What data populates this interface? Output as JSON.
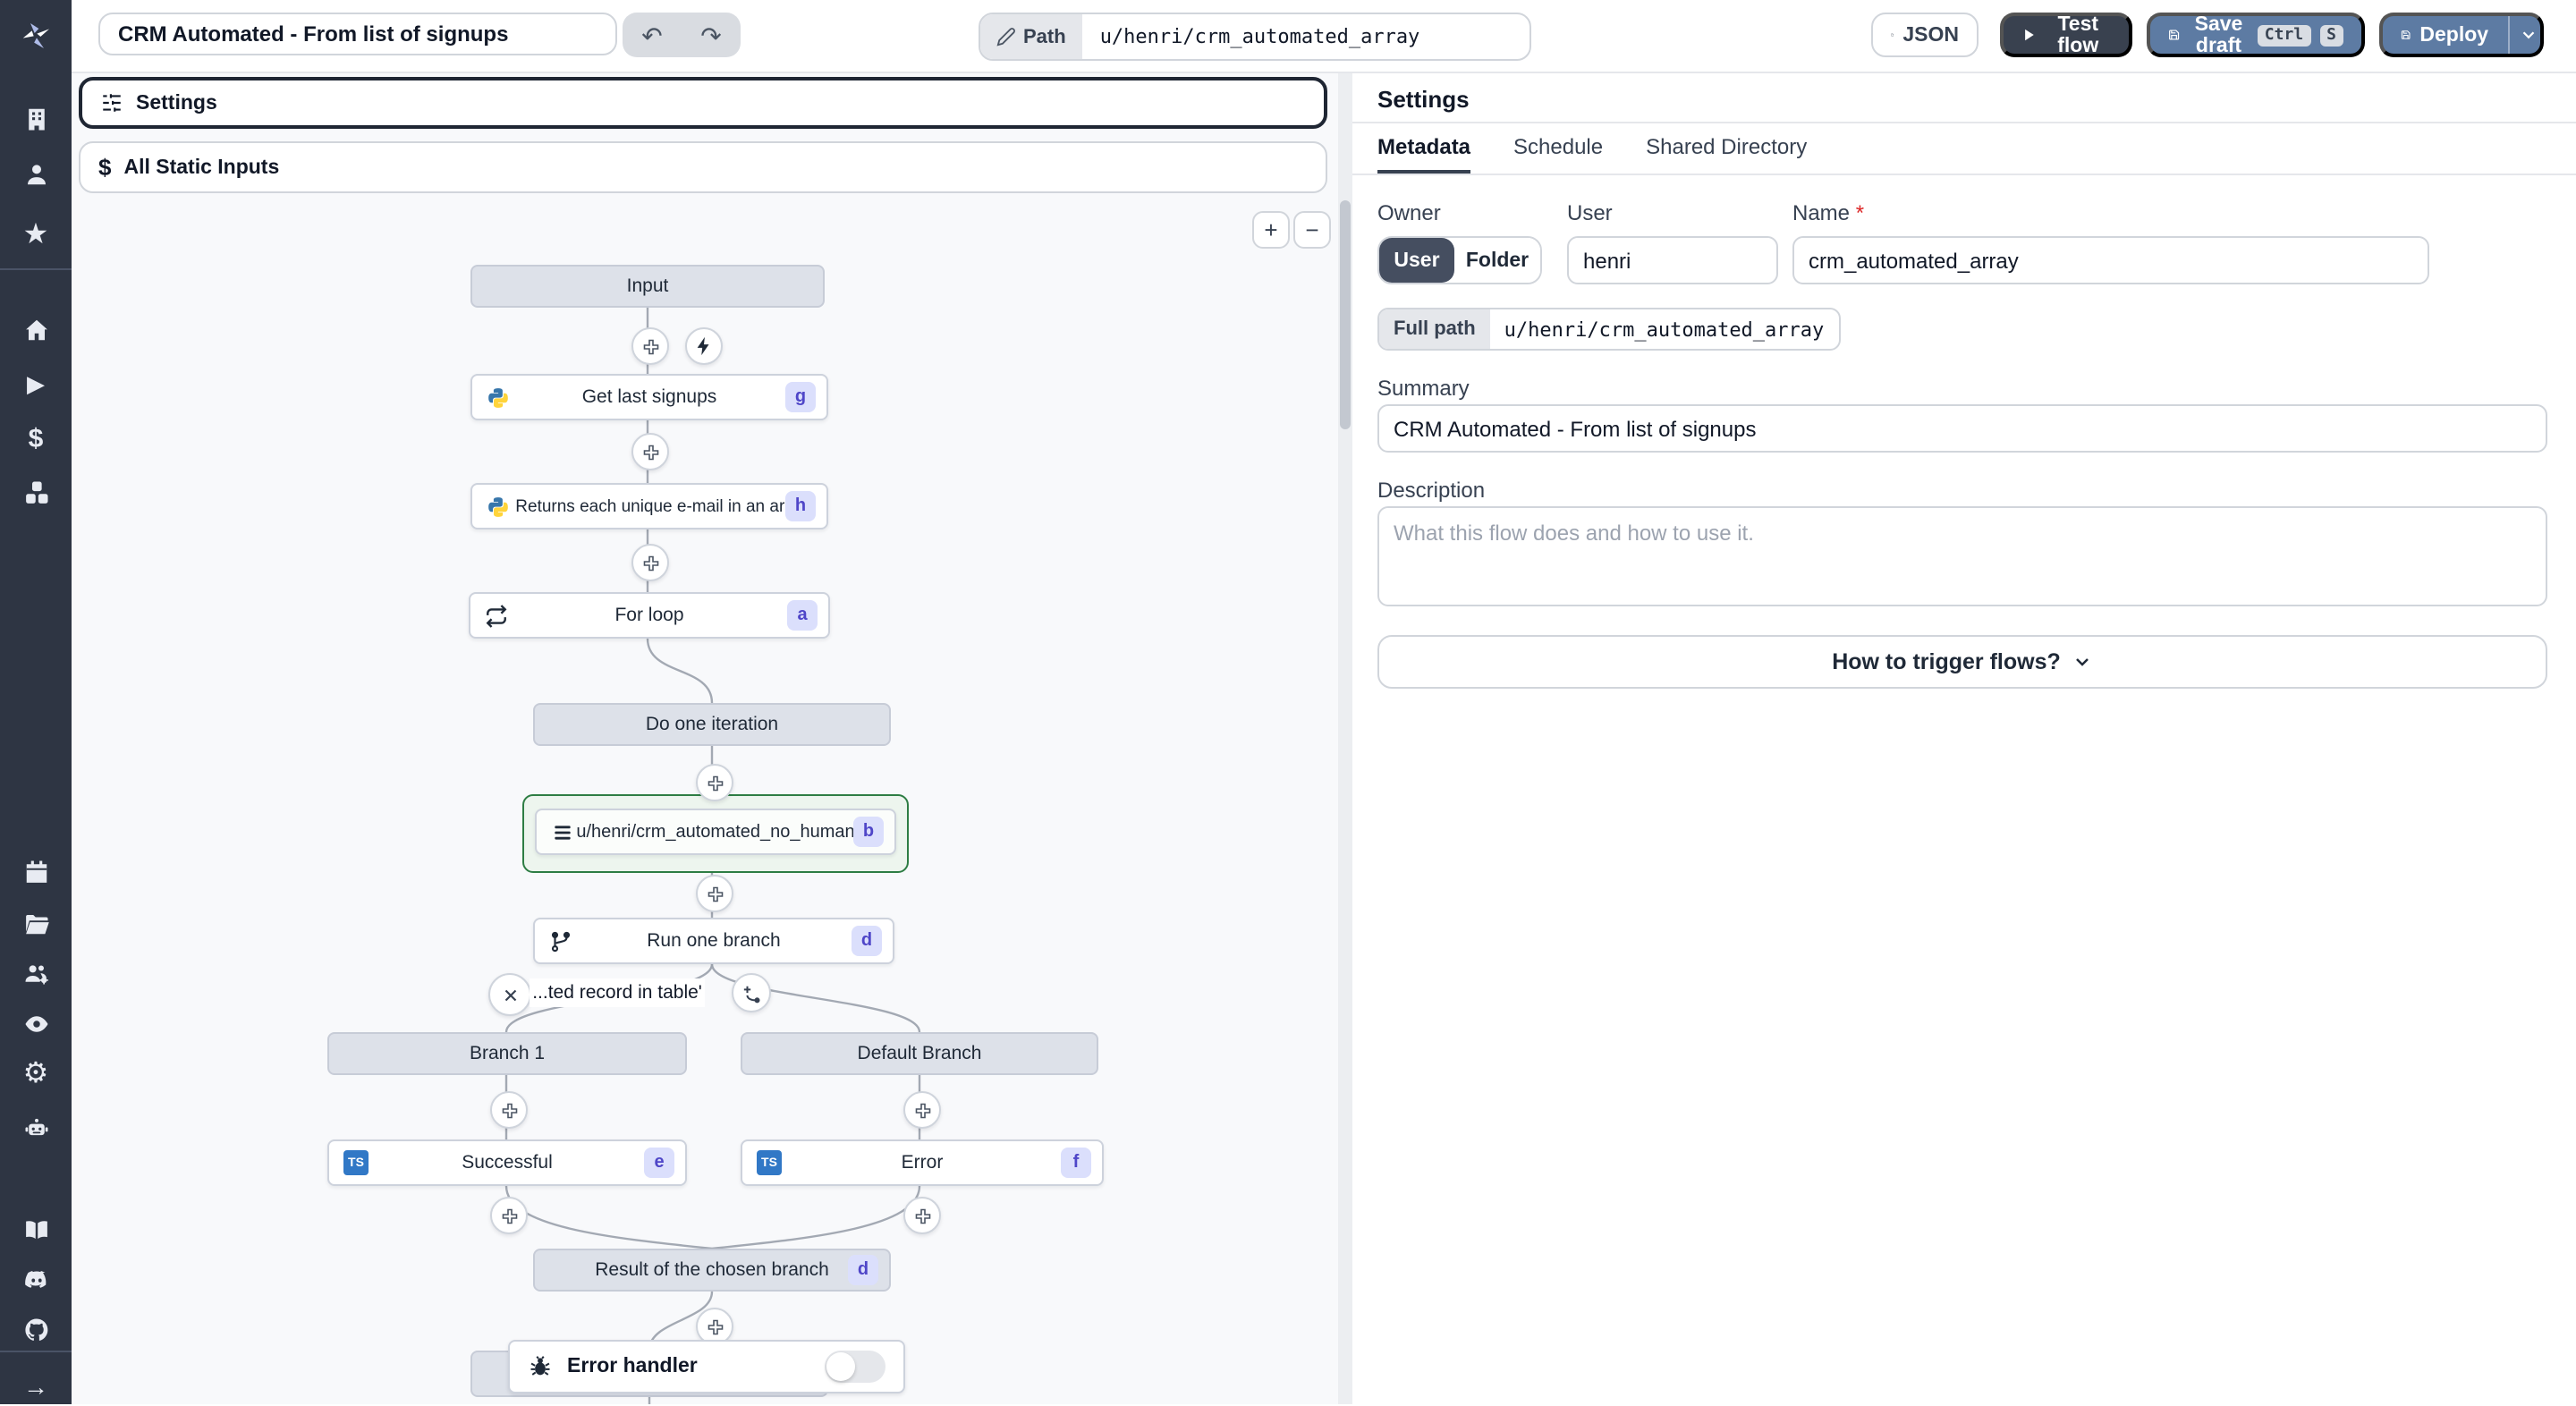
{
  "topbar": {
    "title": "CRM Automated - From list of signups",
    "path_label": "Path",
    "path_value": "u/henri/crm_automated_array",
    "json_button": "JSON",
    "test_flow_button": "Test flow",
    "save_draft_button": "Save draft",
    "kbd_ctrl": "Ctrl",
    "kbd_s": "S",
    "deploy_button": "Deploy"
  },
  "left_panel": {
    "settings_box": "Settings",
    "static_inputs_box": "All Static Inputs",
    "zoom_in": "+",
    "zoom_out": "−"
  },
  "flow": {
    "ts_icon_text": "TS",
    "input": {
      "label": "Input"
    },
    "get_last": {
      "label": "Get last signups",
      "badge": "g",
      "lang": "python"
    },
    "unique_emails": {
      "label": "Returns each unique e-mail in an array",
      "badge": "h",
      "lang": "python"
    },
    "for_loop": {
      "label": "For loop",
      "badge": "a"
    },
    "do_one_iteration": {
      "label": "Do one iteration"
    },
    "script_step": {
      "label": "u/henri/crm_automated_no_human",
      "badge": "b",
      "selected": true
    },
    "run_one_branch": {
      "label": "Run one branch",
      "badge": "d"
    },
    "branch_condition": {
      "label": "...ted record in table'"
    },
    "branch_1": {
      "label": "Branch 1"
    },
    "default_branch": {
      "label": "Default Branch"
    },
    "successful": {
      "label": "Successful",
      "badge": "e",
      "lang": "typescript"
    },
    "error": {
      "label": "Error",
      "badge": "f",
      "lang": "typescript"
    },
    "result": {
      "label": "Result of the chosen branch",
      "badge": "d"
    },
    "error_handler": {
      "label": "Error handler",
      "toggle_on": false
    }
  },
  "settings_panel": {
    "title": "Settings",
    "tabs": [
      {
        "label": "Metadata",
        "active": true
      },
      {
        "label": "Schedule",
        "active": false
      },
      {
        "label": "Shared Directory",
        "active": false
      }
    ],
    "owner_label": "Owner",
    "owner_user": "User",
    "owner_folder": "Folder",
    "user_label": "User",
    "user_value": "henri",
    "name_label": "Name",
    "required_asterisk": "*",
    "name_value": "crm_automated_array",
    "full_path_label": "Full path",
    "full_path_value": "u/henri/crm_automated_array",
    "summary_label": "Summary",
    "summary_value": "CRM Automated - From list of signups",
    "description_label": "Description",
    "description_placeholder": "What this flow does and how to use it.",
    "trigger_button": "How to trigger flows?"
  },
  "icons": {
    "dollar": "$",
    "star": "★",
    "play": "▶",
    "gear": "⚙",
    "arrow_right": "→",
    "undo": "↶",
    "redo": "↷"
  },
  "colors": {
    "sidebar": "#2e3543",
    "accent_blue": "#5d7ba3",
    "dark_button": "#39414f",
    "badge_bg": "#dbdffc",
    "badge_text": "#4f46c8",
    "selected_green": "#2e7d44",
    "ts_blue": "#3178c6"
  }
}
